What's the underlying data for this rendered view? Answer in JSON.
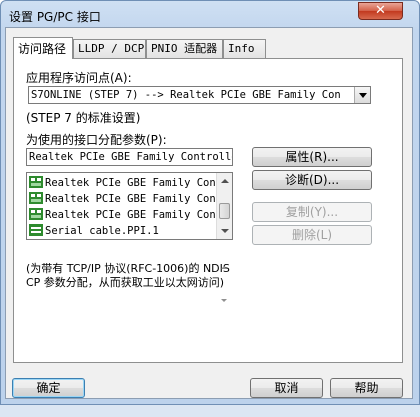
{
  "window": {
    "title": "设置 PG/PC 接口",
    "close_label": "✕"
  },
  "tabs": [
    {
      "label": "访问路径",
      "active": true
    },
    {
      "label": "LLDP / DCP",
      "active": false
    },
    {
      "label": "PNIO 适配器",
      "active": false
    },
    {
      "label": "Info",
      "active": false
    }
  ],
  "access_point": {
    "label": "应用程序访问点(A):",
    "selected_value": "S7ONLINE (STEP 7)         --> Realtek PCIe GBE Family Con",
    "note": "(STEP 7 的标准设置)"
  },
  "interface": {
    "label": "为使用的接口分配参数(P):",
    "value": "Realtek PCIe GBE Family Controller",
    "list": [
      "Realtek PCIe GBE Family Cont",
      "Realtek PCIe GBE Family Cont",
      "Realtek PCIe GBE Family Cont",
      "Serial cable.PPI.1"
    ]
  },
  "side_buttons": {
    "properties": "属性(R)...",
    "diagnostics": "诊断(D)...",
    "copy": "复制(Y)...",
    "delete": "删除(L)"
  },
  "description": "(为带有 TCP/IP 协议(RFC-1006)的 NDIS CP 参数分配，从而获取工业以太网访问)",
  "footer": {
    "ok": "确定",
    "cancel": "取消",
    "help": "帮助"
  },
  "colors": {
    "icon_green": "#2e8b2e",
    "disabled_text": "#a0a0a0"
  }
}
